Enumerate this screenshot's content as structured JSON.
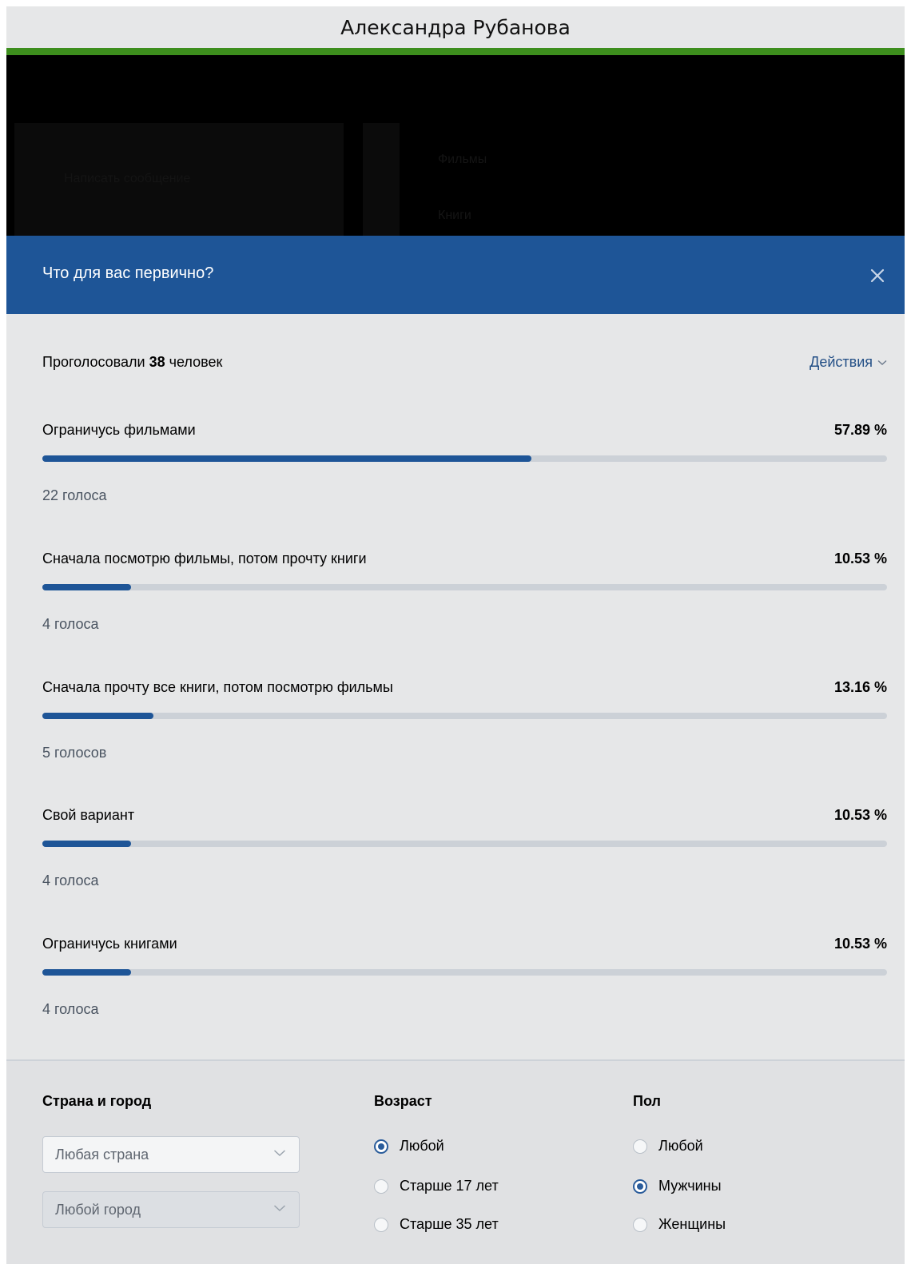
{
  "window": {
    "title": "Александра Рубанова"
  },
  "colors": {
    "accent_green": "#3d8e1d",
    "header_blue": "#1e5597",
    "bar_fill": "#1e5597",
    "bar_track": "#ccd1d7",
    "link_blue": "#234f86"
  },
  "background": {
    "text_1": "Фильмы",
    "text_2": "Книги",
    "text_3": "Написать сообщение"
  },
  "modal": {
    "title": "Что для вас первично?",
    "close_icon": "close-icon",
    "summary": {
      "prefix": "Проголосовали ",
      "count": "38",
      "suffix": " человек"
    },
    "actions_label": "Действия"
  },
  "poll": {
    "options": [
      {
        "label": "Ограничусь фильмами",
        "percent_text": "57.89 %",
        "percent": 57.89,
        "votes": "22 голоса"
      },
      {
        "label": "Сначала посмотрю фильмы, потом прочту книги",
        "percent_text": "10.53 %",
        "percent": 10.53,
        "votes": "4 голоса"
      },
      {
        "label": "Сначала прочту все книги, потом посмотрю фильмы",
        "percent_text": "13.16 %",
        "percent": 13.16,
        "votes": "5 голосов"
      },
      {
        "label": "Свой вариант",
        "percent_text": "10.53 %",
        "percent": 10.53,
        "votes": "4 голоса"
      },
      {
        "label": "Ограничусь книгами",
        "percent_text": "10.53 %",
        "percent": 10.53,
        "votes": "4 голоса"
      }
    ]
  },
  "filters": {
    "location": {
      "heading": "Страна и город",
      "country": "Любая страна",
      "city": "Любой город"
    },
    "age": {
      "heading": "Возраст",
      "options": [
        "Любой",
        "Старше 17 лет",
        "Старше 35 лет"
      ],
      "selected": 0
    },
    "gender": {
      "heading": "Пол",
      "options": [
        "Любой",
        "Мужчины",
        "Женщины"
      ],
      "selected": 1
    }
  }
}
